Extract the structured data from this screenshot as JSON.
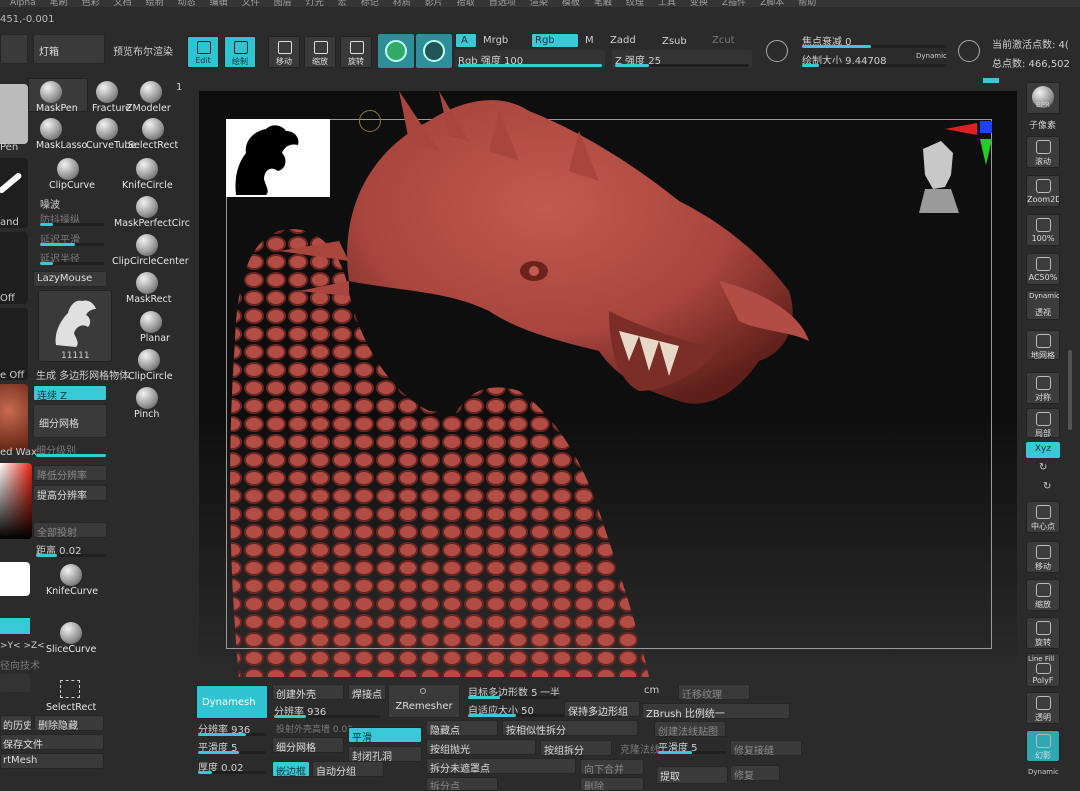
{
  "menu": [
    "Alpha",
    "笔刷",
    "色彩",
    "文档",
    "绘制",
    "动态",
    "编辑",
    "文件",
    "图层",
    "灯光",
    "宏",
    "标记",
    "材质",
    "影片",
    "拾取",
    "首选项",
    "渲染",
    "模板",
    "笔触",
    "纹理",
    "工具",
    "变换",
    "Z插件",
    "Z脚本",
    "帮助"
  ],
  "coord_readout": "451,-0.001",
  "top_left": {
    "lightbox": "灯箱",
    "preview_render": "预览布尔渲染"
  },
  "top_tools": [
    {
      "label": "Edit",
      "on": true
    },
    {
      "label": "绘制",
      "on": true
    },
    {
      "label": "移动",
      "on": false
    },
    {
      "label": "缩放",
      "on": false
    },
    {
      "label": "旋转",
      "on": false
    }
  ],
  "color_section": {
    "a_label": "A",
    "mrgb": "Mrgb",
    "rgb": "Rgb",
    "m": "M",
    "zadd": "Zadd",
    "zsub": "Zsub",
    "zcut": "Zcut",
    "rgb_intensity": "Rgb 强度 100",
    "z_intensity": "Z 强度 25",
    "rgb_intensity_value": 100,
    "z_intensity_value": 25
  },
  "focal": {
    "focal_shift": "焦点衰减 0",
    "draw_size": "绘制大小 9.44708",
    "dynamic": "Dynamic",
    "draw_size_value": 9.44708
  },
  "points": {
    "active": "当前激活点数: 4(",
    "total": "总点数: 466,502"
  },
  "brushes": [
    {
      "name": "MaskPen"
    },
    {
      "name": "Fracture"
    },
    {
      "name": "ZModeler"
    },
    {
      "name": "MaskLasso"
    },
    {
      "name": "CurveTube"
    },
    {
      "name": "SelectRect"
    },
    {
      "name": "ClipCurve"
    },
    {
      "name": "KnifeCircle"
    },
    {
      "name": "MaskPerfectCirc"
    },
    {
      "name": "ClipCircleCenter"
    },
    {
      "name": "MaskRect"
    },
    {
      "name": "Planar"
    },
    {
      "name": "ClipCircle"
    },
    {
      "name": "Pinch"
    },
    {
      "name": "KnifeCurve"
    },
    {
      "name": "SliceCurve"
    },
    {
      "name": "SelectRect"
    }
  ],
  "left_panel": {
    "one": "1",
    "pen_label": "Pen",
    "and_label": "and",
    "off_label": "Off",
    "e_off_label": "e Off",
    "ed_wax": "ed Wax",
    "noise": "噪波",
    "anti_jitter": "防抖操纵",
    "lazy_smooth": "延迟平滑",
    "lazy_radius": "延迟半径",
    "lazymouse": "LazyMouse",
    "tool_count": "11111",
    "gen_polymesh": "生成 多边形网格物体",
    "continuous_z": "连续 Z",
    "subdivide": "细分网格",
    "subdiv_level": "细分级别",
    "lower_subdiv": "降低分辨率",
    "higher_subdiv": "提高分辨率",
    "project_all": "全部投射",
    "distance": "距离 0.02",
    "distance_value": 0.02,
    "sym_axes": ">Y< >Z<",
    "dir_tech": "径向技术",
    "history": "的历史",
    "delete_hidden": "删除隐藏",
    "save_file": "保存文件",
    "rt_mesh": "rtMesh"
  },
  "right_panel": [
    {
      "label": "BPR"
    },
    {
      "label": "子像素"
    },
    {
      "label": "滚动"
    },
    {
      "label": "Zoom2D"
    },
    {
      "label": "100%"
    },
    {
      "label": "AC50%"
    },
    {
      "label": "Dynamic"
    },
    {
      "label": "透视"
    },
    {
      "label": "地网格"
    },
    {
      "label": "对称"
    },
    {
      "label": "局部"
    },
    {
      "label": "Xyz"
    },
    {
      "label": "中心点"
    },
    {
      "label": "移动"
    },
    {
      "label": "缩放"
    },
    {
      "label": "旋转"
    },
    {
      "label": "Line Fill"
    },
    {
      "label": "PolyF"
    },
    {
      "label": "透明"
    },
    {
      "label": "幻影"
    },
    {
      "label": "Dynamic"
    }
  ],
  "bottom": {
    "dynamesh": "Dynamesh",
    "create_shell": "创建外壳",
    "weld": "焊接点",
    "zremesher": "ZRemesher",
    "target_poly": "目标多边形数 5",
    "half": "一半",
    "cm": "cm",
    "transfer_texture": "迁移纹理",
    "resolution_936": "分辨率 936",
    "adaptive_size": "自适应大小 50",
    "keep_polygroups": "保持多边形组",
    "zbrush_unify": "ZBrush 比例统一",
    "resolution_left": "分辨率 936",
    "project_shell": "投射外壳",
    "gap": "高墙 0.02",
    "smooth": "平滑",
    "hide_pt": "隐藏点",
    "split_similar": "按相似性拆分",
    "create_normal": "创建法线贴图",
    "smooth_5": "平滑度 5",
    "subdivide_mesh": "细分网格",
    "close_holes": "封闭孔洞",
    "group_polish": "按组抛光",
    "split_groups": "按组拆分",
    "polish_normal": "克隆法线",
    "smooth_level": "平滑度 5",
    "repair": "修复接缝",
    "thickness": "厚度 0.02",
    "edge_loop": "嵌边框",
    "auto_group": "自动分组",
    "split_unmasked": "拆分未遮罩点",
    "merge_down": "向下合并",
    "split_points": "拆分点",
    "delete": "删除",
    "extract": "提取",
    "fix": "修复"
  },
  "colors": {
    "accent": "#39c9d6",
    "dragon": "#a8453d",
    "bg": "#2b2b2b"
  }
}
